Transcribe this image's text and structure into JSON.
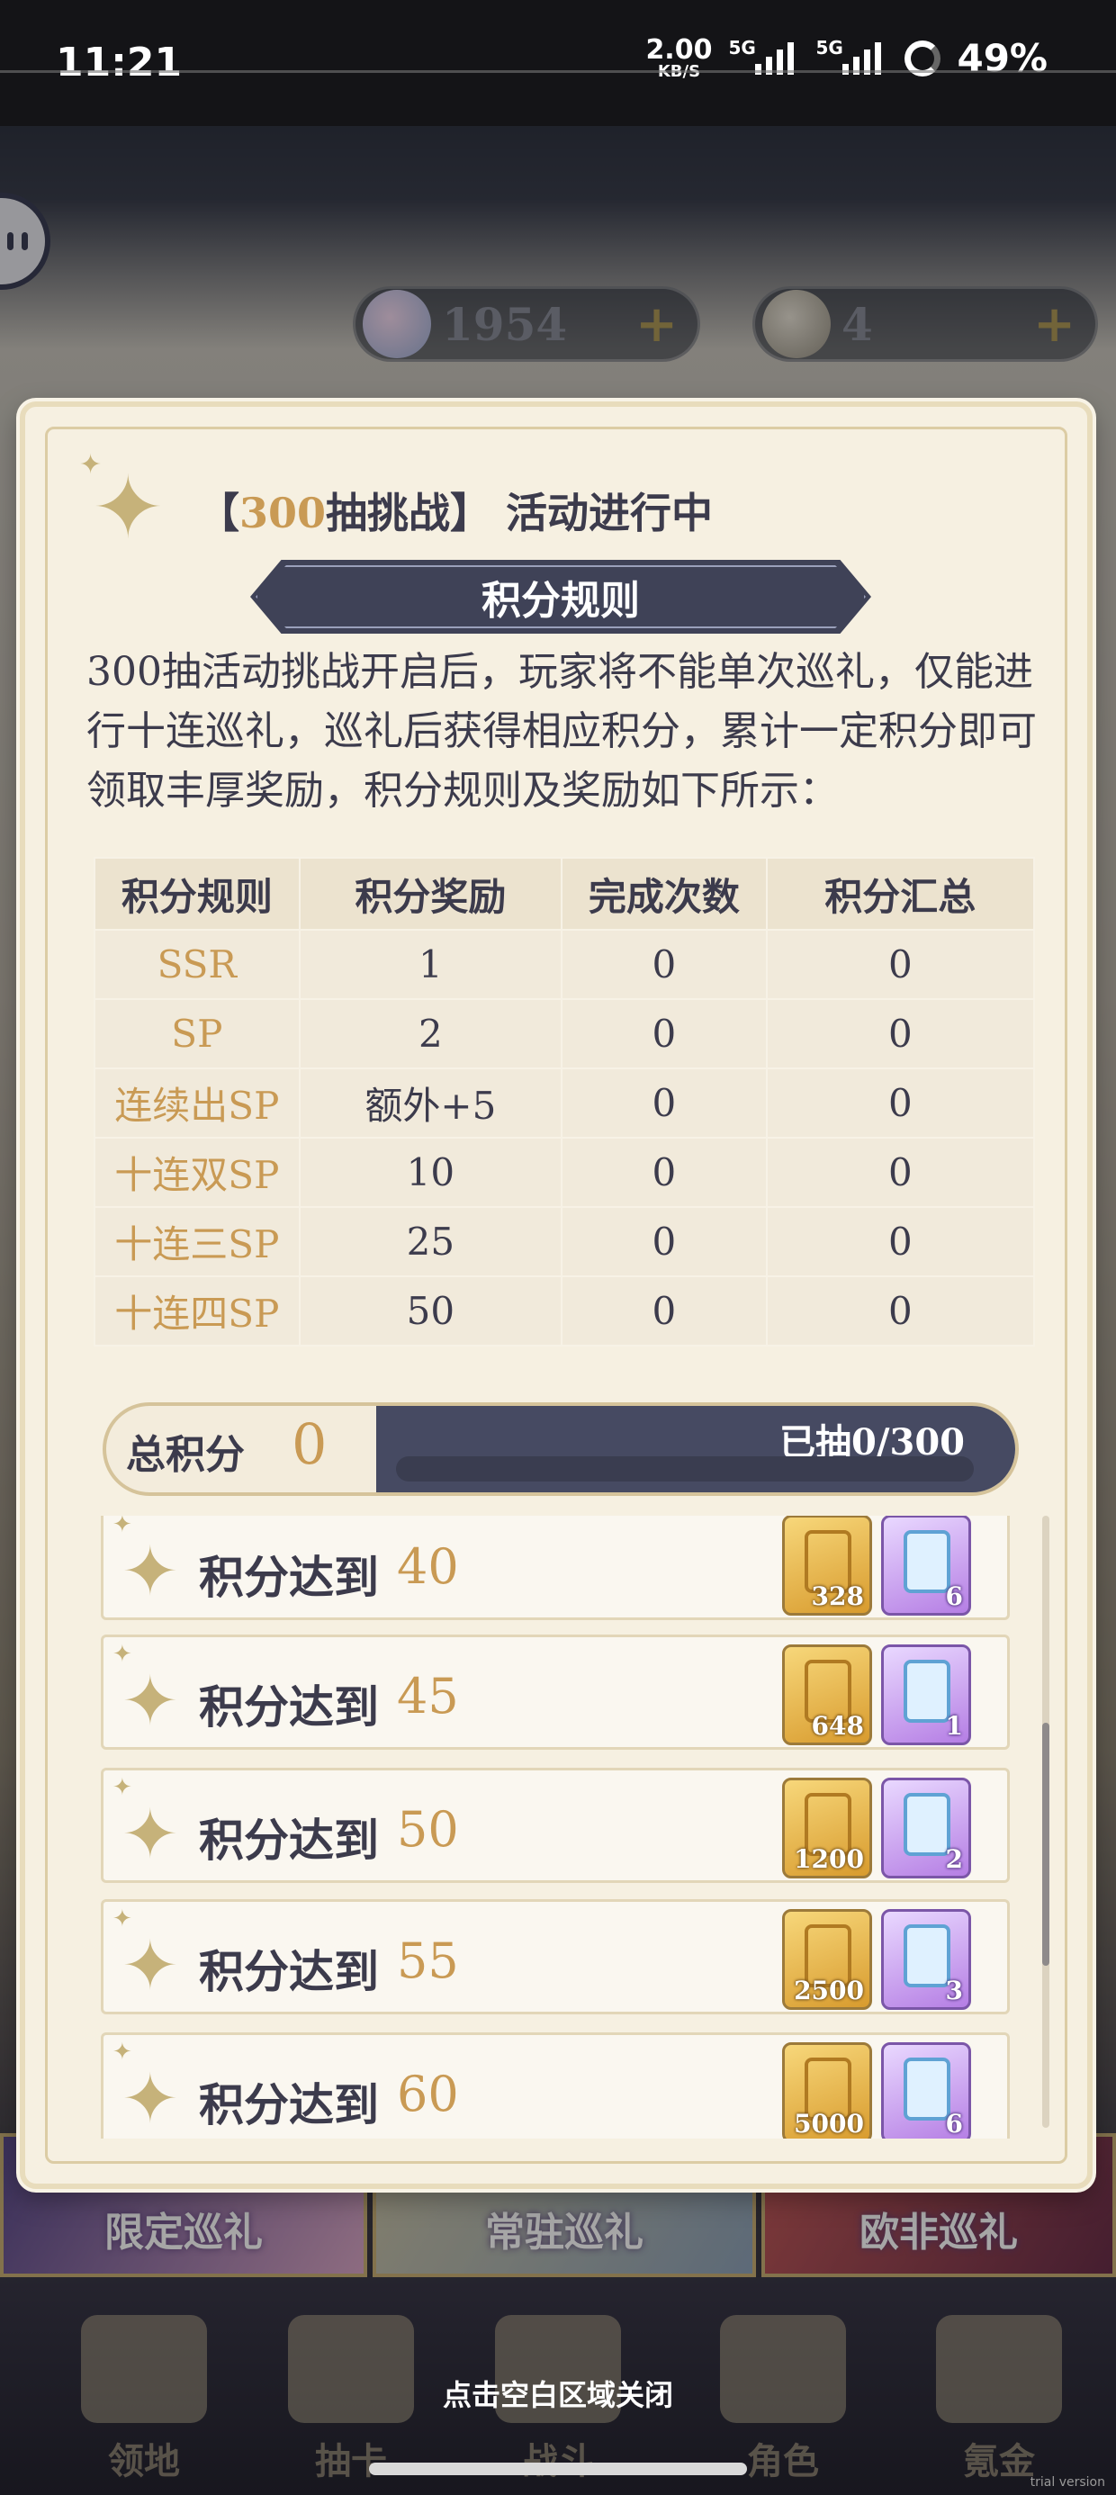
{
  "status_bar": {
    "time": "11:21",
    "net_speed_value": "2.00",
    "net_speed_unit": "KB/S",
    "signal1_tag": "5G",
    "signal2_tag": "5G",
    "battery": "49%"
  },
  "currencies": [
    {
      "icon": "crystal-icon",
      "value": "1954",
      "plus": "+"
    },
    {
      "icon": "scroll-ticket-icon",
      "value": "4",
      "plus": "+"
    }
  ],
  "panel": {
    "title_prefix": "【",
    "title_highlight": "300",
    "title_rest": "抽挑战】 活动进行中",
    "rules_title": "积分规则",
    "description": "300抽活动挑战开启后，玩家将不能单次巡礼，仅能进行十连巡礼，巡礼后获得相应积分，累计一定积分即可领取丰厚奖励，积分规则及奖励如下所示："
  },
  "table": {
    "headers": [
      "积分规则",
      "积分奖励",
      "完成次数",
      "积分汇总"
    ],
    "rows": [
      [
        "SSR",
        "1",
        "0",
        "0"
      ],
      [
        "SP",
        "2",
        "0",
        "0"
      ],
      [
        "连续出SP",
        "额外+5",
        "0",
        "0"
      ],
      [
        "十连双SP",
        "10",
        "0",
        "0"
      ],
      [
        "十连三SP",
        "25",
        "0",
        "0"
      ],
      [
        "十连四SP",
        "50",
        "0",
        "0"
      ]
    ]
  },
  "total": {
    "label": "总积分",
    "value": "0",
    "progress_text": "已抽0/300",
    "progress_fraction": 0
  },
  "tiers": [
    {
      "label": "积分达到",
      "value": "40",
      "gold_count": "328",
      "purple_count": "6"
    },
    {
      "label": "积分达到",
      "value": "45",
      "gold_count": "648",
      "purple_count": "1"
    },
    {
      "label": "积分达到",
      "value": "50",
      "gold_count": "1200",
      "purple_count": "2"
    },
    {
      "label": "积分达到",
      "value": "55",
      "gold_count": "2500",
      "purple_count": "3"
    },
    {
      "label": "积分达到",
      "value": "60",
      "gold_count": "5000",
      "purple_count": "6"
    }
  ],
  "banners": [
    "限定巡礼",
    "常驻巡礼",
    "欧非巡礼"
  ],
  "nav": [
    "领地",
    "抽卡",
    "战斗",
    "角色",
    "氪金"
  ],
  "close_hint": "点击空白区域关闭",
  "watermark": "trial version",
  "colors": {
    "accent_gold": "#c99a54",
    "ink": "#3c3b4c",
    "ribbon": "#3f4257",
    "panel_bg": "#f6f0e1"
  }
}
